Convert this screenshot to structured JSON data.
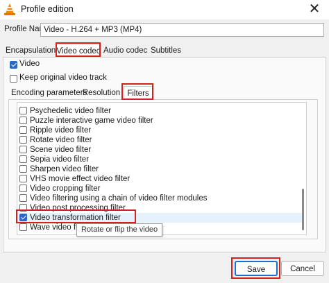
{
  "window": {
    "title": "Profile edition",
    "close_glyph": "✕",
    "icon": "vlc-cone-icon"
  },
  "profile": {
    "label": "Profile Name",
    "value": "Video - H.264 + MP3 (MP4)"
  },
  "main_tabs": [
    {
      "label": "Encapsulation"
    },
    {
      "label": "Video codec",
      "selected": true
    },
    {
      "label": "Audio codec"
    },
    {
      "label": "Subtitles"
    }
  ],
  "video_options": {
    "video_label": "Video",
    "video_checked": true,
    "keep_label": "Keep original video track",
    "keep_checked": false
  },
  "sub_tabs": [
    {
      "label": "Encoding parameters"
    },
    {
      "label": "Resolution"
    },
    {
      "label": "Filters",
      "selected": true
    }
  ],
  "filters": [
    {
      "label": "Psychedelic video filter",
      "checked": false
    },
    {
      "label": "Puzzle interactive game video filter",
      "checked": false
    },
    {
      "label": "Ripple video filter",
      "checked": false
    },
    {
      "label": "Rotate video filter",
      "checked": false
    },
    {
      "label": "Scene video filter",
      "checked": false
    },
    {
      "label": "Sepia video filter",
      "checked": false
    },
    {
      "label": "Sharpen video filter",
      "checked": false
    },
    {
      "label": "VHS movie effect video filter",
      "checked": false
    },
    {
      "label": "Video cropping filter",
      "checked": false
    },
    {
      "label": "Video filtering using a chain of video filter modules",
      "checked": false
    },
    {
      "label": "Video post processing filter",
      "checked": false
    },
    {
      "label": "Video transformation filter",
      "checked": true,
      "selected": true
    },
    {
      "label": "Wave video filter",
      "checked": false
    }
  ],
  "tooltip": "Rotate or flip the video",
  "buttons": {
    "save": "Save",
    "cancel": "Cancel"
  },
  "colors": {
    "highlight": "#d32020",
    "accent": "#2b66c4"
  }
}
